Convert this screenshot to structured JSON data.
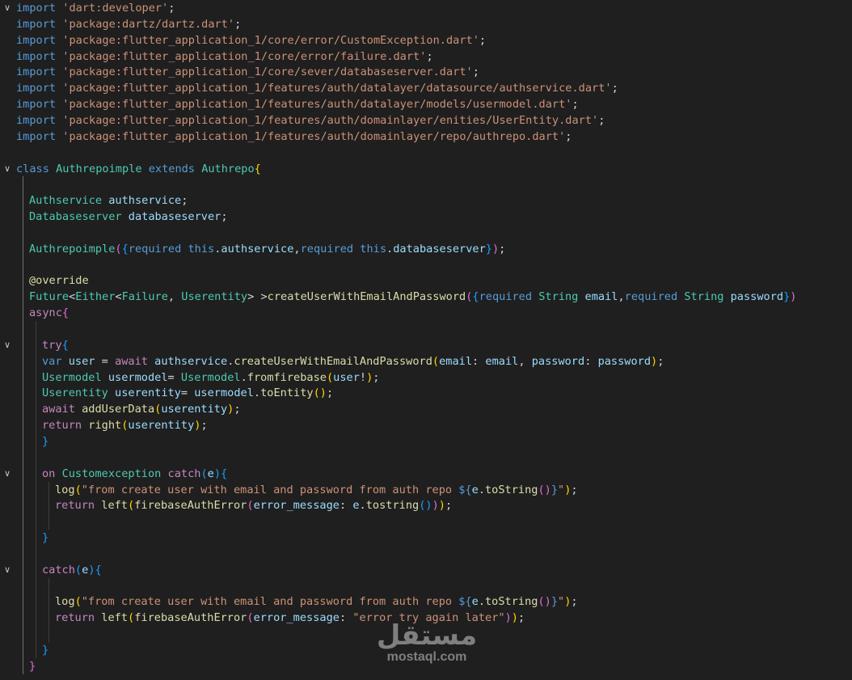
{
  "editor": {
    "language": "dart",
    "lines": [
      {
        "fold": "open",
        "indent": 0,
        "tokens": [
          [
            "kw",
            "import"
          ],
          [
            "txt",
            " "
          ],
          [
            "str",
            "'dart:developer'"
          ],
          [
            "txt",
            ";"
          ]
        ]
      },
      {
        "indent": 0,
        "tokens": [
          [
            "kw",
            "import"
          ],
          [
            "txt",
            " "
          ],
          [
            "str",
            "'package:dartz/dartz.dart'"
          ],
          [
            "txt",
            ";"
          ]
        ]
      },
      {
        "indent": 0,
        "tokens": [
          [
            "kw",
            "import"
          ],
          [
            "txt",
            " "
          ],
          [
            "str",
            "'package:flutter_application_1/core/error/CustomException.dart'"
          ],
          [
            "txt",
            ";"
          ]
        ]
      },
      {
        "indent": 0,
        "tokens": [
          [
            "kw",
            "import"
          ],
          [
            "txt",
            " "
          ],
          [
            "str",
            "'package:flutter_application_1/core/error/failure.dart'"
          ],
          [
            "txt",
            ";"
          ]
        ]
      },
      {
        "indent": 0,
        "tokens": [
          [
            "kw",
            "import"
          ],
          [
            "txt",
            " "
          ],
          [
            "str",
            "'package:flutter_application_1/core/sever/databaseserver.dart'"
          ],
          [
            "txt",
            ";"
          ]
        ]
      },
      {
        "indent": 0,
        "tokens": [
          [
            "kw",
            "import"
          ],
          [
            "txt",
            " "
          ],
          [
            "str",
            "'package:flutter_application_1/features/auth/datalayer/datasource/authservice.dart'"
          ],
          [
            "txt",
            ";"
          ]
        ]
      },
      {
        "indent": 0,
        "tokens": [
          [
            "kw",
            "import"
          ],
          [
            "txt",
            " "
          ],
          [
            "str",
            "'package:flutter_application_1/features/auth/datalayer/models/usermodel.dart'"
          ],
          [
            "txt",
            ";"
          ]
        ]
      },
      {
        "indent": 0,
        "tokens": [
          [
            "kw",
            "import"
          ],
          [
            "txt",
            " "
          ],
          [
            "str",
            "'package:flutter_application_1/features/auth/domainlayer/enities/UserEntity.dart'"
          ],
          [
            "txt",
            ";"
          ]
        ]
      },
      {
        "indent": 0,
        "tokens": [
          [
            "kw",
            "import"
          ],
          [
            "txt",
            " "
          ],
          [
            "str",
            "'package:flutter_application_1/features/auth/domainlayer/repo/authrepo.dart'"
          ],
          [
            "txt",
            ";"
          ]
        ]
      },
      {
        "indent": 0,
        "tokens": []
      },
      {
        "fold": "open",
        "indent": 0,
        "tokens": [
          [
            "kw",
            "class"
          ],
          [
            "txt",
            " "
          ],
          [
            "cls",
            "Authrepoimple"
          ],
          [
            "txt",
            " "
          ],
          [
            "kw",
            "extends"
          ],
          [
            "txt",
            " "
          ],
          [
            "cls",
            "Authrepo"
          ],
          [
            "b1",
            "{"
          ]
        ]
      },
      {
        "indent": 1,
        "tokens": []
      },
      {
        "indent": 1,
        "tokens": [
          [
            "cls",
            "Authservice"
          ],
          [
            "txt",
            " "
          ],
          [
            "var",
            "authservice"
          ],
          [
            "txt",
            ";"
          ]
        ]
      },
      {
        "indent": 1,
        "tokens": [
          [
            "cls",
            "Databaseserver"
          ],
          [
            "txt",
            " "
          ],
          [
            "var",
            "databaseserver"
          ],
          [
            "txt",
            ";"
          ]
        ]
      },
      {
        "indent": 1,
        "tokens": []
      },
      {
        "indent": 1,
        "tokens": [
          [
            "cls",
            "Authrepoimple"
          ],
          [
            "b2",
            "("
          ],
          [
            "b3",
            "{"
          ],
          [
            "kw",
            "required"
          ],
          [
            "txt",
            " "
          ],
          [
            "kw",
            "this"
          ],
          [
            "txt",
            "."
          ],
          [
            "var",
            "authservice"
          ],
          [
            "txt",
            ","
          ],
          [
            "kw",
            "required"
          ],
          [
            "txt",
            " "
          ],
          [
            "kw",
            "this"
          ],
          [
            "txt",
            "."
          ],
          [
            "var",
            "databaseserver"
          ],
          [
            "b3",
            "}"
          ],
          [
            "b2",
            ")"
          ],
          [
            "txt",
            ";"
          ]
        ]
      },
      {
        "indent": 1,
        "tokens": []
      },
      {
        "indent": 1,
        "tokens": [
          [
            "ann",
            "@override"
          ]
        ]
      },
      {
        "indent": 1,
        "tokens": [
          [
            "cls",
            "Future"
          ],
          [
            "txt",
            "<"
          ],
          [
            "cls",
            "Either"
          ],
          [
            "txt",
            "<"
          ],
          [
            "cls",
            "Failure"
          ],
          [
            "txt",
            ", "
          ],
          [
            "cls",
            "Userentity"
          ],
          [
            "txt",
            "> >"
          ],
          [
            "fn",
            "createUserWithEmailAndPassword"
          ],
          [
            "b2",
            "("
          ],
          [
            "b3",
            "{"
          ],
          [
            "kw",
            "required"
          ],
          [
            "txt",
            " "
          ],
          [
            "cls",
            "String"
          ],
          [
            "txt",
            " "
          ],
          [
            "var",
            "email"
          ],
          [
            "txt",
            ","
          ],
          [
            "kw",
            "required"
          ],
          [
            "txt",
            " "
          ],
          [
            "cls",
            "String"
          ],
          [
            "txt",
            " "
          ],
          [
            "var",
            "password"
          ],
          [
            "b3",
            "}"
          ],
          [
            "b2",
            ")"
          ]
        ]
      },
      {
        "indent": 1,
        "tokens": [
          [
            "ctl",
            "async"
          ],
          [
            "b2",
            "{"
          ]
        ]
      },
      {
        "indent": 2,
        "tokens": []
      },
      {
        "fold": "open",
        "indent": 2,
        "tokens": [
          [
            "ctl",
            "try"
          ],
          [
            "b3",
            "{"
          ]
        ]
      },
      {
        "indent": 2,
        "tokens": [
          [
            "kw",
            "var"
          ],
          [
            "txt",
            " "
          ],
          [
            "var",
            "user"
          ],
          [
            "txt",
            " = "
          ],
          [
            "ctl",
            "await"
          ],
          [
            "txt",
            " "
          ],
          [
            "var",
            "authservice"
          ],
          [
            "txt",
            "."
          ],
          [
            "fn",
            "createUserWithEmailAndPassword"
          ],
          [
            "b1",
            "("
          ],
          [
            "var",
            "email"
          ],
          [
            "txt",
            ": "
          ],
          [
            "var",
            "email"
          ],
          [
            "txt",
            ", "
          ],
          [
            "var",
            "password"
          ],
          [
            "txt",
            ": "
          ],
          [
            "var",
            "password"
          ],
          [
            "b1",
            ")"
          ],
          [
            "txt",
            ";"
          ]
        ]
      },
      {
        "indent": 2,
        "tokens": [
          [
            "cls",
            "Usermodel"
          ],
          [
            "txt",
            " "
          ],
          [
            "var",
            "usermodel"
          ],
          [
            "txt",
            "= "
          ],
          [
            "cls",
            "Usermodel"
          ],
          [
            "txt",
            "."
          ],
          [
            "fn",
            "fromfirebase"
          ],
          [
            "b1",
            "("
          ],
          [
            "var",
            "user"
          ],
          [
            "txt",
            "!"
          ],
          [
            "b1",
            ")"
          ],
          [
            "txt",
            ";"
          ]
        ]
      },
      {
        "indent": 2,
        "tokens": [
          [
            "cls",
            "Userentity"
          ],
          [
            "txt",
            " "
          ],
          [
            "var",
            "userentity"
          ],
          [
            "txt",
            "= "
          ],
          [
            "var",
            "usermodel"
          ],
          [
            "txt",
            "."
          ],
          [
            "fn",
            "toEntity"
          ],
          [
            "b1",
            "()"
          ],
          [
            "txt",
            ";"
          ]
        ]
      },
      {
        "indent": 2,
        "tokens": [
          [
            "ctl",
            "await"
          ],
          [
            "txt",
            " "
          ],
          [
            "fn",
            "addUserData"
          ],
          [
            "b1",
            "("
          ],
          [
            "var",
            "userentity"
          ],
          [
            "b1",
            ")"
          ],
          [
            "txt",
            ";"
          ]
        ]
      },
      {
        "indent": 2,
        "tokens": [
          [
            "ctl",
            "return"
          ],
          [
            "txt",
            " "
          ],
          [
            "fn",
            "right"
          ],
          [
            "b1",
            "("
          ],
          [
            "var",
            "userentity"
          ],
          [
            "b1",
            ")"
          ],
          [
            "txt",
            ";"
          ]
        ]
      },
      {
        "indent": 2,
        "tokens": [
          [
            "b3",
            "}"
          ]
        ]
      },
      {
        "indent": 2,
        "tokens": []
      },
      {
        "fold": "open",
        "indent": 2,
        "tokens": [
          [
            "ctl",
            "on"
          ],
          [
            "txt",
            " "
          ],
          [
            "cls",
            "Customexception"
          ],
          [
            "txt",
            " "
          ],
          [
            "ctl",
            "catch"
          ],
          [
            "b3",
            "("
          ],
          [
            "var",
            "e"
          ],
          [
            "b3",
            ")"
          ],
          [
            "b3",
            "{"
          ]
        ]
      },
      {
        "indent": 3,
        "tokens": [
          [
            "fn",
            "log"
          ],
          [
            "b1",
            "("
          ],
          [
            "str",
            "\"from create user with email and password from auth repo "
          ],
          [
            "kw",
            "${"
          ],
          [
            "var",
            "e"
          ],
          [
            "txt",
            "."
          ],
          [
            "fn",
            "toString"
          ],
          [
            "b2",
            "()"
          ],
          [
            "kw",
            "}"
          ],
          [
            "str",
            "\""
          ],
          [
            "b1",
            ")"
          ],
          [
            "txt",
            ";"
          ]
        ]
      },
      {
        "indent": 3,
        "tokens": [
          [
            "ctl",
            "return"
          ],
          [
            "txt",
            " "
          ],
          [
            "fn",
            "left"
          ],
          [
            "b1",
            "("
          ],
          [
            "fn",
            "firebaseAuthError"
          ],
          [
            "b2",
            "("
          ],
          [
            "var",
            "error_message"
          ],
          [
            "txt",
            ": "
          ],
          [
            "var",
            "e"
          ],
          [
            "txt",
            "."
          ],
          [
            "fn",
            "tostring"
          ],
          [
            "b3",
            "()"
          ],
          [
            "b2",
            ")"
          ],
          [
            "b1",
            ")"
          ],
          [
            "txt",
            ";"
          ]
        ]
      },
      {
        "indent": 3,
        "tokens": []
      },
      {
        "indent": 2,
        "tokens": [
          [
            "b3",
            "}"
          ]
        ]
      },
      {
        "indent": 2,
        "tokens": []
      },
      {
        "fold": "open",
        "indent": 2,
        "tokens": [
          [
            "ctl",
            "catch"
          ],
          [
            "b3",
            "("
          ],
          [
            "var",
            "e"
          ],
          [
            "b3",
            ")"
          ],
          [
            "b3",
            "{"
          ]
        ]
      },
      {
        "indent": 3,
        "tokens": []
      },
      {
        "indent": 3,
        "tokens": [
          [
            "fn",
            "log"
          ],
          [
            "b1",
            "("
          ],
          [
            "str",
            "\"from create user with email and password from auth repo "
          ],
          [
            "kw",
            "${"
          ],
          [
            "var",
            "e"
          ],
          [
            "txt",
            "."
          ],
          [
            "fn",
            "toString"
          ],
          [
            "b2",
            "()"
          ],
          [
            "kw",
            "}"
          ],
          [
            "str",
            "\""
          ],
          [
            "b1",
            ")"
          ],
          [
            "txt",
            ";"
          ]
        ]
      },
      {
        "indent": 3,
        "tokens": [
          [
            "ctl",
            "return"
          ],
          [
            "txt",
            " "
          ],
          [
            "fn",
            "left"
          ],
          [
            "b1",
            "("
          ],
          [
            "fn",
            "firebaseAuthError"
          ],
          [
            "b2",
            "("
          ],
          [
            "var",
            "error_message"
          ],
          [
            "txt",
            ": "
          ],
          [
            "str",
            "\"error try again later\""
          ],
          [
            "b2",
            ")"
          ],
          [
            "b1",
            ")"
          ],
          [
            "txt",
            ";"
          ]
        ]
      },
      {
        "indent": 3,
        "tokens": []
      },
      {
        "indent": 2,
        "tokens": [
          [
            "b3",
            "}"
          ]
        ]
      },
      {
        "indent": 1,
        "tokens": [
          [
            "b2",
            "}"
          ]
        ]
      }
    ]
  },
  "watermark": {
    "arabic": "مستقل",
    "latin": "mostaql.com"
  }
}
